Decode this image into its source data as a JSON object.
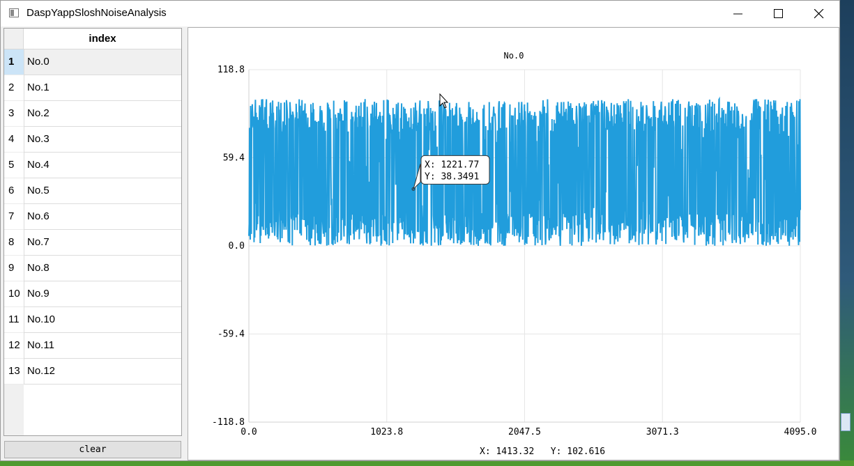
{
  "window": {
    "title": "DaspYappSloshNoiseAnalysis"
  },
  "table": {
    "column_header": "index",
    "rows": [
      {
        "num": "1",
        "label": "No.0"
      },
      {
        "num": "2",
        "label": "No.1"
      },
      {
        "num": "3",
        "label": "No.2"
      },
      {
        "num": "4",
        "label": "No.3"
      },
      {
        "num": "5",
        "label": "No.4"
      },
      {
        "num": "6",
        "label": "No.5"
      },
      {
        "num": "7",
        "label": "No.6"
      },
      {
        "num": "8",
        "label": "No.7"
      },
      {
        "num": "9",
        "label": "No.8"
      },
      {
        "num": "10",
        "label": "No.9"
      },
      {
        "num": "11",
        "label": "No.10"
      },
      {
        "num": "12",
        "label": "No.11"
      },
      {
        "num": "13",
        "label": "No.12"
      }
    ],
    "selected_index": 0
  },
  "clear_button": "clear",
  "chart_data": {
    "type": "line",
    "title": "No.0",
    "xlim": [
      0.0,
      4095.0
    ],
    "ylim": [
      -118.8,
      118.8
    ],
    "x_ticks": [
      "0.0",
      "1023.8",
      "2047.5",
      "3071.3",
      "4095.0"
    ],
    "y_ticks": [
      "118.8",
      "59.4",
      "0.0",
      "-59.4",
      "-118.8"
    ],
    "series": [
      {
        "color": "#219ddc",
        "x_range": [
          0,
          4095
        ],
        "y_range": [
          0,
          99
        ],
        "baseline": 50,
        "samples": 4096
      }
    ],
    "grid": true,
    "tooltip": {
      "x_label": "X: 1221.77",
      "y_label": "Y: 38.3491",
      "x": 1221.77,
      "y": 38.3491
    }
  },
  "cursor_readout": {
    "x": "X: 1413.32",
    "y": "Y: 102.616"
  }
}
